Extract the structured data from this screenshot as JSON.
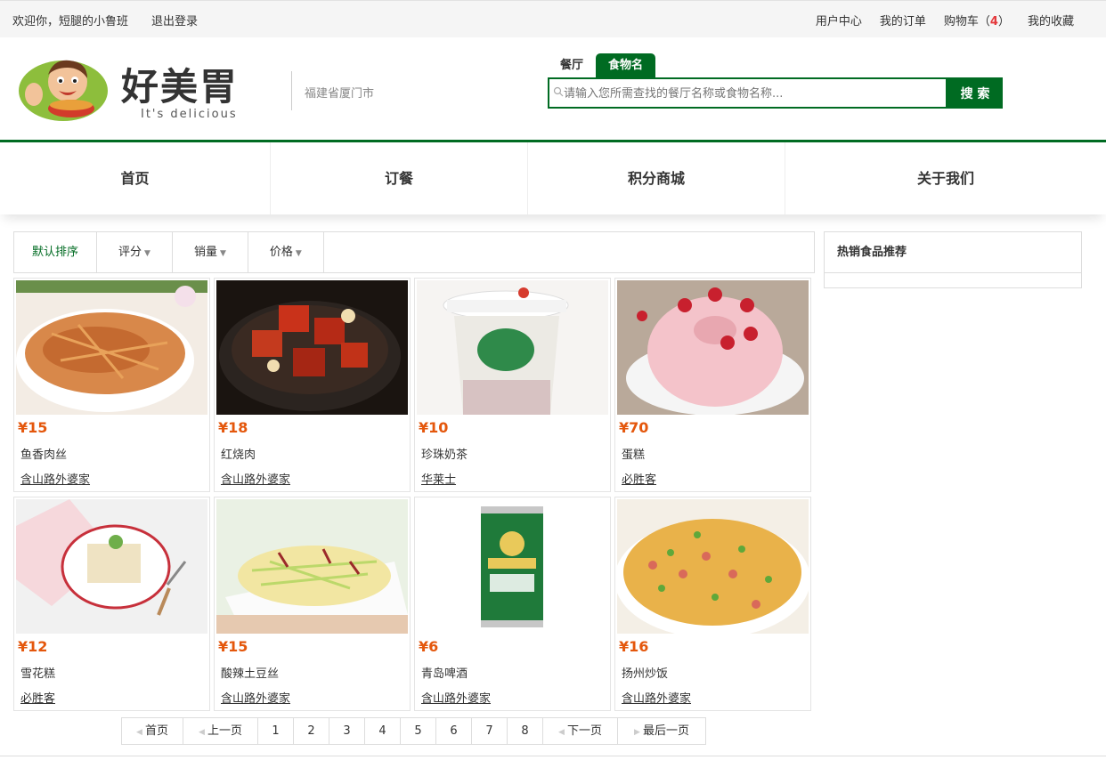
{
  "topbar": {
    "welcome": "欢迎你，短腿的小鲁班",
    "logout": "退出登录",
    "user_center": "用户中心",
    "my_orders": "我的订单",
    "cart_label": "购物车（",
    "cart_count": "4",
    "cart_close": "）",
    "favorites": "我的收藏"
  },
  "header": {
    "logo_text": "好美胃",
    "logo_sub": "It's delicious",
    "location": "福建省厦门市",
    "search_tabs": [
      "餐厅",
      "食物名"
    ],
    "search_placeholder": "请输入您所需查找的餐厅名称或食物名称...",
    "search_button": "搜 索"
  },
  "nav": [
    "首页",
    "订餐",
    "积分商城",
    "关于我们"
  ],
  "sortbar": {
    "default": "默认排序",
    "rating": "评分",
    "sales": "销量",
    "price": "价格"
  },
  "products": [
    {
      "price": "¥15",
      "name": "鱼香肉丝",
      "shop": "含山路外婆家",
      "image": "shredded-pork"
    },
    {
      "price": "¥18",
      "name": "红烧肉",
      "shop": "含山路外婆家",
      "image": "braised-pork"
    },
    {
      "price": "¥10",
      "name": "珍珠奶茶",
      "shop": "华莱士",
      "image": "bubble-tea"
    },
    {
      "price": "¥70",
      "name": "蛋糕",
      "shop": "必胜客",
      "image": "strawberry-cake"
    },
    {
      "price": "¥12",
      "name": "雪花糕",
      "shop": "必胜客",
      "image": "snow-cake"
    },
    {
      "price": "¥15",
      "name": "酸辣土豆丝",
      "shop": "含山路外婆家",
      "image": "potato-shreds"
    },
    {
      "price": "¥6",
      "name": "青岛啤酒",
      "shop": "含山路外婆家",
      "image": "beer-can"
    },
    {
      "price": "¥16",
      "name": "扬州炒饭",
      "shop": "含山路外婆家",
      "image": "fried-rice"
    }
  ],
  "hot": {
    "title": "热销食品推荐"
  },
  "pagination": {
    "first": "首页",
    "prev": "上一页",
    "pages": [
      "1",
      "2",
      "3",
      "4",
      "5",
      "6",
      "7",
      "8"
    ],
    "next": "下一页",
    "last": "最后一页"
  },
  "colors": {
    "brand": "#006b22",
    "price": "#e4570c",
    "cart_count": "#e4393c"
  }
}
